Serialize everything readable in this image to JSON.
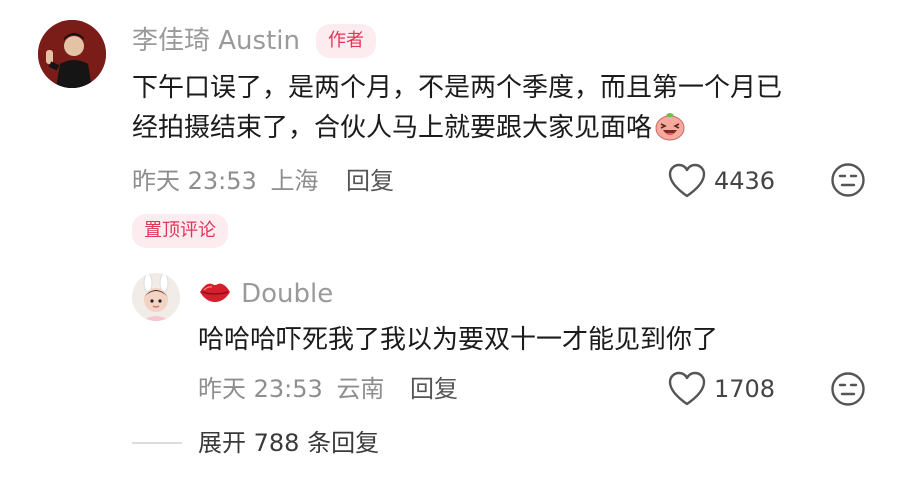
{
  "comment": {
    "author_name": "李佳琦 Austin",
    "author_badge": "作者",
    "text_line1": "下午口误了，是两个月，不是两个季度，而且第一个月已",
    "text_line2": "经拍摄结束了，合伙人马上就要跟大家见面咯",
    "time": "昨天 23:53",
    "location": "上海",
    "reply_label": "回复",
    "like_count": "4436",
    "pinned_label": "置顶评论",
    "emoji_icon": "pig-laugh-emoji-icon"
  },
  "reply": {
    "author_name": "Double",
    "name_icon": "lips-icon",
    "text": "哈哈哈吓死我了我以为要双十一才能见到你了",
    "time": "昨天 23:53",
    "location": "云南",
    "reply_label": "回复",
    "like_count": "1708"
  },
  "expand": {
    "label": "展开 788 条回复"
  },
  "colors": {
    "badge_text": "#e0365a",
    "badge_bg": "#fdecef",
    "meta_text": "#8e8e8e"
  }
}
